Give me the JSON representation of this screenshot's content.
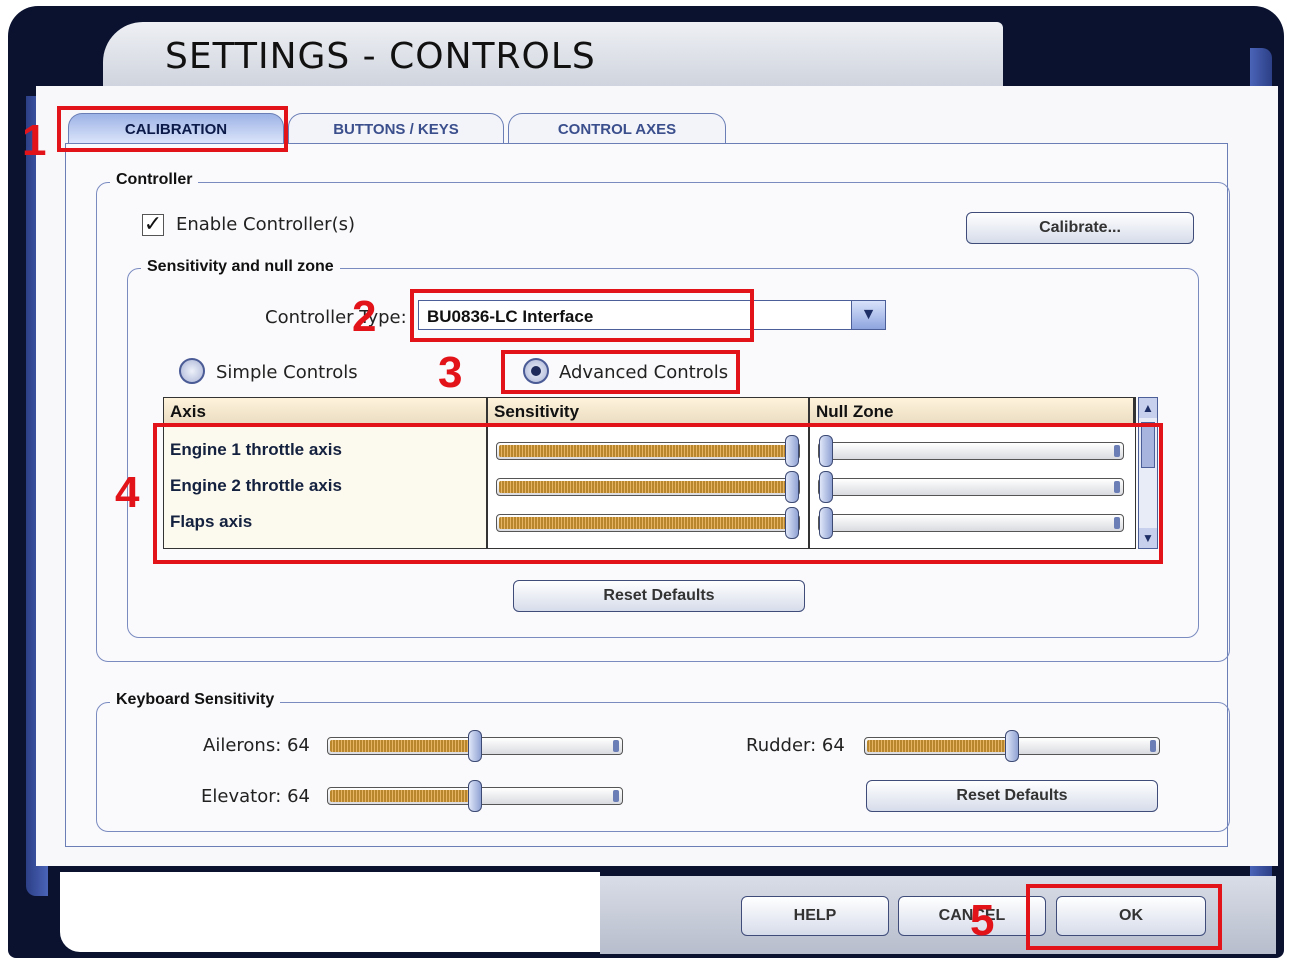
{
  "window": {
    "title": "SETTINGS - CONTROLS"
  },
  "tabs": [
    {
      "label": "CALIBRATION",
      "active": true
    },
    {
      "label": "BUTTONS / KEYS",
      "active": false
    },
    {
      "label": "CONTROL AXES",
      "active": false
    }
  ],
  "controller": {
    "group_label": "Controller",
    "enable_label": "Enable Controller(s)",
    "enable_checked": true,
    "calibrate_label": "Calibrate...",
    "sensitivity_group_label": "Sensitivity and null zone",
    "controller_type_label": "Controller Type:",
    "controller_type_value": "BU0836-LC Interface",
    "simple_controls_label": "Simple Controls",
    "advanced_controls_label": "Advanced Controls",
    "mode_selected": "Advanced Controls",
    "columns": [
      "Axis",
      "Sensitivity",
      "Null Zone"
    ],
    "rows": [
      {
        "axis": "Engine 1 throttle axis",
        "sensitivity": 1.0,
        "null_zone": 0.0
      },
      {
        "axis": "Engine 2 throttle axis",
        "sensitivity": 1.0,
        "null_zone": 0.0
      },
      {
        "axis": "Flaps axis",
        "sensitivity": 1.0,
        "null_zone": 0.0
      }
    ],
    "reset_defaults_label": "Reset Defaults"
  },
  "keyboard": {
    "group_label": "Keyboard Sensitivity",
    "ailerons_label": "Ailerons: 64",
    "elevator_label": "Elevator: 64",
    "rudder_label": "Rudder: 64",
    "ailerons_value": 0.5,
    "elevator_value": 0.5,
    "rudder_value": 0.5,
    "reset_defaults_label": "Reset Defaults"
  },
  "footer": {
    "help_label": "HELP",
    "cancel_label": "CANCEL",
    "ok_label": "OK"
  },
  "annotations": {
    "n1": "1",
    "n2": "2",
    "n3": "3",
    "n4": "4",
    "n5": "5"
  },
  "colors": {
    "annotation": "#e3131a",
    "frame": "#2c3f86",
    "slider_fill": "#b8862c"
  }
}
